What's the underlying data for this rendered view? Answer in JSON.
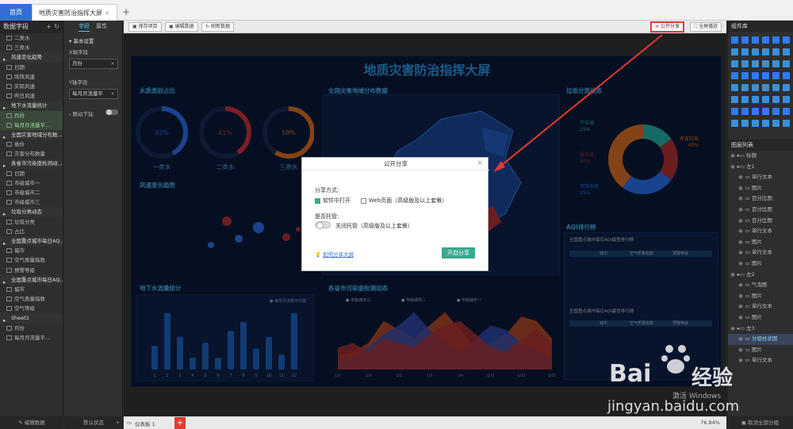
{
  "tabs": {
    "home": "首页",
    "screen": "地质灾害防治指挥大屏",
    "add": "+"
  },
  "left_panel": {
    "title": "数据字段",
    "rows": [
      {
        "label": "二类水",
        "kind": "field"
      },
      {
        "label": "三类水",
        "kind": "field"
      },
      {
        "label": "风速变化趋势",
        "kind": "group"
      },
      {
        "label": "日期",
        "kind": "field"
      },
      {
        "label": "阵阵风速",
        "kind": "field"
      },
      {
        "label": "实际风速",
        "kind": "field"
      },
      {
        "label": "昨日风速",
        "kind": "field"
      },
      {
        "label": "地下水流量统计",
        "kind": "group"
      },
      {
        "label": "月份",
        "kind": "selected"
      },
      {
        "label": "每月月流量平...",
        "kind": "selected"
      },
      {
        "label": "全国灾害地域分布数...",
        "kind": "group"
      },
      {
        "label": "省份",
        "kind": "field"
      },
      {
        "label": "灾害分布数量",
        "kind": "field"
      },
      {
        "label": "各省市污染度检测动...",
        "kind": "group"
      },
      {
        "label": "日期",
        "kind": "field"
      },
      {
        "label": "市级城市一",
        "kind": "field"
      },
      {
        "label": "市级城市二",
        "kind": "field"
      },
      {
        "label": "市级城市三",
        "kind": "field"
      },
      {
        "label": "垃圾分类动态",
        "kind": "group"
      },
      {
        "label": "垃圾分类",
        "kind": "field"
      },
      {
        "label": "占比",
        "kind": "field"
      },
      {
        "label": "全国重点城市每日AQ...",
        "kind": "group"
      },
      {
        "label": "城市",
        "kind": "field"
      },
      {
        "label": "空气质量指数",
        "kind": "field"
      },
      {
        "label": "预警等级",
        "kind": "field"
      },
      {
        "label": "全国重点城市每日AQ...",
        "kind": "group"
      },
      {
        "label": "城市",
        "kind": "field"
      },
      {
        "label": "空气质量指数",
        "kind": "field"
      },
      {
        "label": "空气等级",
        "kind": "field"
      },
      {
        "label": "Sheet1",
        "kind": "group"
      },
      {
        "label": "月份",
        "kind": "field"
      },
      {
        "label": "每月月流量平...",
        "kind": "field"
      }
    ],
    "footer": "编辑数据"
  },
  "mid_panel": {
    "tab_field": "字段",
    "tab_attr": "属性",
    "section": "基本设置",
    "x_label": "X轴字段",
    "x_value": "月份",
    "y_label": "Y轴字段",
    "y_value": "每月月流量平",
    "drill_label": "联动下钻",
    "footer": "默认状态"
  },
  "toolbar": {
    "save": "保存项目",
    "edit_data": "编辑数据",
    "refresh": "刷新数据",
    "share": "公开分享",
    "fullscreen": "全屏播放"
  },
  "board": {
    "title": "地质灾害防治指挥大屏",
    "panel_water": "水质类别占比",
    "panel_map": "全国灾害地域分布数据",
    "panel_trash": "垃圾分类动态",
    "panel_wind": "风速变化趋势",
    "panel_aqi": "AQI排行榜",
    "panel_ground": "地下水流量统计",
    "panel_pollution": "各省市污染度检测动态",
    "aqi_sub1": "全国重点城市每日AQI最差排行榜",
    "aqi_sub2": "全国重点城市每日AQI最优排行榜",
    "aqi_headers": [
      "城市",
      "空气质量指数",
      "预警等级"
    ],
    "trash_labels": [
      "干垃圾",
      "湿垃圾",
      "可回收物",
      "有害垃圾"
    ],
    "trash_pcts": [
      "15%",
      "20%",
      "25%",
      "40%"
    ]
  },
  "chart_data": [
    {
      "type": "pie",
      "title": "水质类别占比",
      "categories": [
        "一类水",
        "二类水",
        "三类水"
      ],
      "values": [
        42,
        41,
        59
      ],
      "colors": [
        "#2f7bff",
        "#e0383e",
        "#f07a2a"
      ]
    },
    {
      "type": "pie",
      "title": "垃圾分类动态",
      "categories": [
        "干垃圾",
        "湿垃圾",
        "可回收物",
        "有害垃圾"
      ],
      "values": [
        15,
        20,
        25,
        40
      ],
      "colors": [
        "#29c5b8",
        "#c0373a",
        "#2f7bff",
        "#f07a2a"
      ]
    },
    {
      "type": "bar",
      "title": "地下水流量统计",
      "categories": [
        "1",
        "2",
        "3",
        "4",
        "5",
        "6",
        "7",
        "8",
        "9",
        "10",
        "11",
        "12"
      ],
      "values": [
        40,
        95,
        55,
        20,
        45,
        20,
        65,
        80,
        35,
        55,
        25,
        95
      ],
      "ylim": [
        0,
        100
      ],
      "legend": "每月月流量平均值",
      "color": "#1f6ed4"
    },
    {
      "type": "area",
      "title": "各省市污染度检测动态",
      "categories": [
        "1/1",
        "1/2",
        "1/3",
        "1/4",
        "1/5",
        "1/6",
        "1/7",
        "1/8",
        "1/9",
        "1/10",
        "1/11",
        "1/12",
        "1/13",
        "1/14",
        "1/15"
      ],
      "series": [
        {
          "name": "市级城市三",
          "values": [
            30,
            40,
            60,
            110,
            90,
            70,
            100,
            130,
            90,
            50,
            60,
            80,
            120,
            110,
            70
          ],
          "color": "#e05a2a"
        },
        {
          "name": "市级城市二",
          "values": [
            20,
            30,
            50,
            80,
            100,
            130,
            90,
            60,
            40,
            70,
            100,
            90,
            60,
            40,
            30
          ],
          "color": "#3a57c8"
        },
        {
          "name": "市级城市一",
          "values": [
            50,
            60,
            40,
            70,
            60,
            50,
            80,
            100,
            110,
            80,
            50,
            40,
            70,
            90,
            60
          ],
          "color": "#c0373a"
        }
      ],
      "ylim": [
        0,
        140
      ]
    }
  ],
  "modal": {
    "title": "公开分享",
    "close": "×",
    "share_mode_label": "分享方式:",
    "option_software": "软件中打开",
    "option_web": "Web页面（高级版及以上套餐）",
    "hosting_label": "是否托管:",
    "hosting_off": "关闭托管（高级版及以上套餐）",
    "help_link": "如何分享大屏",
    "start_button": "开启分享"
  },
  "right_panel": {
    "widgets_title": "组件库",
    "layers_title": "图层列表",
    "layers": [
      {
        "label": "标题",
        "indent": 0
      },
      {
        "label": "左1",
        "indent": 0
      },
      {
        "label": "单行文本",
        "indent": 1
      },
      {
        "label": "图片",
        "indent": 1
      },
      {
        "label": "百分比图",
        "indent": 1
      },
      {
        "label": "百分比图",
        "indent": 1
      },
      {
        "label": "百分比图",
        "indent": 1
      },
      {
        "label": "单行文本",
        "indent": 1
      },
      {
        "label": "图片",
        "indent": 1
      },
      {
        "label": "单行文本",
        "indent": 1
      },
      {
        "label": "图片",
        "indent": 1
      },
      {
        "label": "左2",
        "indent": 0
      },
      {
        "label": "气泡图",
        "indent": 1
      },
      {
        "label": "图片",
        "indent": 1
      },
      {
        "label": "单行文本",
        "indent": 1
      },
      {
        "label": "图片",
        "indent": 1
      },
      {
        "label": "左3",
        "indent": 0
      },
      {
        "label": "分组柱状图",
        "indent": 1
      },
      {
        "label": "图片",
        "indent": 1
      },
      {
        "label": "单行文本",
        "indent": 1
      }
    ],
    "footer": "取消全部分组"
  },
  "statusbar": {
    "page": "仪表板 1",
    "add": "+",
    "zoom": "76.84%"
  },
  "watermark": {
    "brand_a": "Bai",
    "brand_b": "经验",
    "url": "jingyan.baidu.com",
    "activate": "激活 Windows"
  }
}
